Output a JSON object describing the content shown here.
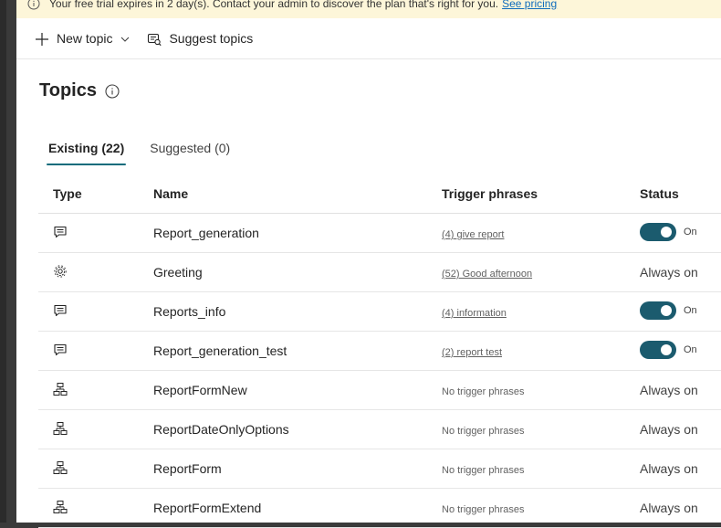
{
  "banner": {
    "text": "Your free trial expires in 2 day(s). Contact your admin to discover the plan that's right for you.",
    "link": "See pricing"
  },
  "commandbar": {
    "new_topic": "New topic",
    "suggest_topics": "Suggest topics"
  },
  "page": {
    "title": "Topics"
  },
  "tabs": [
    {
      "label": "Existing (22)",
      "active": true
    },
    {
      "label": "Suggested (0)",
      "active": false
    }
  ],
  "table": {
    "headers": {
      "type": "Type",
      "name": "Name",
      "trigger": "Trigger phrases",
      "status": "Status"
    },
    "rows": [
      {
        "type_icon": "chat-icon",
        "name": "Report_generation",
        "trigger": "(4) give report",
        "trigger_is_link": true,
        "status": "On",
        "status_kind": "toggle"
      },
      {
        "type_icon": "gear-icon",
        "name": "Greeting",
        "trigger": "(52) Good afternoon",
        "trigger_is_link": true,
        "status": "Always on",
        "status_kind": "text"
      },
      {
        "type_icon": "chat-icon",
        "name": "Reports_info",
        "trigger": "(4) information",
        "trigger_is_link": true,
        "status": "On",
        "status_kind": "toggle"
      },
      {
        "type_icon": "chat-icon",
        "name": "Report_generation_test",
        "trigger": "(2) report test",
        "trigger_is_link": true,
        "status": "On",
        "status_kind": "toggle"
      },
      {
        "type_icon": "flow-icon",
        "name": "ReportFormNew",
        "trigger": "No trigger phrases",
        "trigger_is_link": false,
        "status": "Always on",
        "status_kind": "text"
      },
      {
        "type_icon": "flow-icon",
        "name": "ReportDateOnlyOptions",
        "trigger": "No trigger phrases",
        "trigger_is_link": false,
        "status": "Always on",
        "status_kind": "text"
      },
      {
        "type_icon": "flow-icon",
        "name": "ReportForm",
        "trigger": "No trigger phrases",
        "trigger_is_link": false,
        "status": "Always on",
        "status_kind": "text"
      },
      {
        "type_icon": "flow-icon",
        "name": "ReportFormExtend",
        "trigger": "No trigger phrases",
        "trigger_is_link": false,
        "status": "Always on",
        "status_kind": "text"
      }
    ]
  },
  "colors": {
    "toggle_on": "#1b5b6e",
    "tab_underline": "#0f6c7c",
    "banner_bg": "#fdf6d9"
  }
}
